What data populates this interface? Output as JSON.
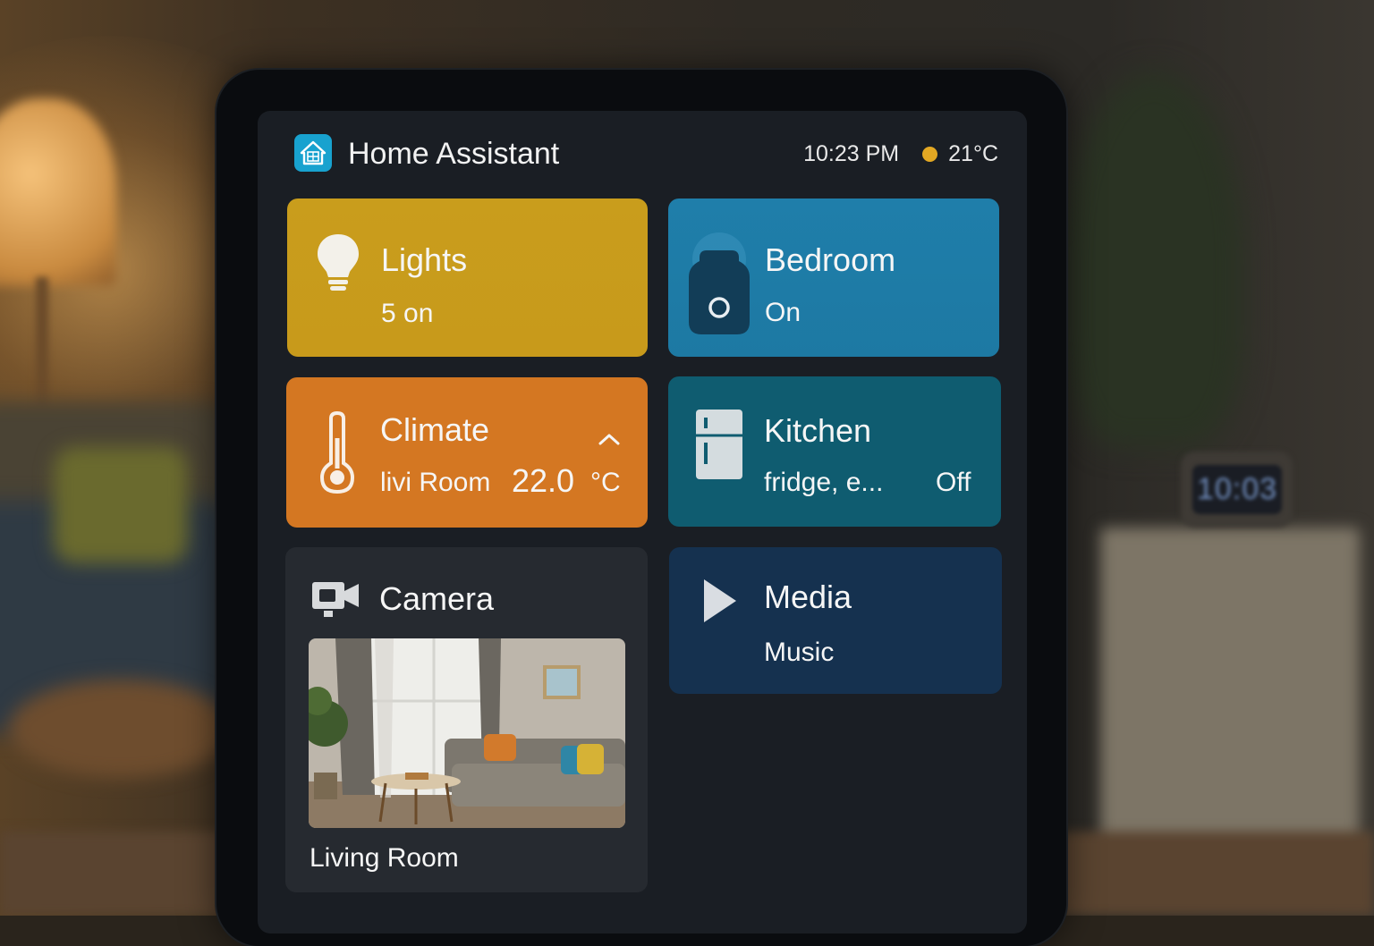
{
  "header": {
    "title": "Home Assistant",
    "time": "10:23 PM",
    "temperature": "21°C",
    "logo_icon": "home-assistant-house-icon"
  },
  "background_clock": "10:03",
  "cards": {
    "lights": {
      "title": "Lights",
      "subtitle": "5 on",
      "icon": "lightbulb-icon",
      "color": "#c99d1c"
    },
    "bedroom": {
      "title": "Bedroom",
      "subtitle": "On",
      "icon": "smart-plug-icon",
      "color": "#1f7eaa"
    },
    "climate": {
      "title": "Climate",
      "room": "livi Room",
      "value": "22.0",
      "unit": "°C",
      "icon": "thermometer-icon",
      "expand_icon": "chevron-up-icon",
      "color": "#d47722"
    },
    "kitchen": {
      "title": "Kitchen",
      "subtitle": "fridge, e...",
      "state": "Off",
      "icon": "fridge-icon",
      "color": "#0f5c70"
    },
    "camera": {
      "title": "Camera",
      "caption": "Living Room",
      "icon": "video-camera-icon",
      "color": "#262a30"
    },
    "media": {
      "title": "Media",
      "subtitle": "Music",
      "icon": "play-icon",
      "color": "#15314f"
    }
  },
  "accent_colors": {
    "weather_dot": "#e3a823",
    "logo": "#18a2cf"
  }
}
